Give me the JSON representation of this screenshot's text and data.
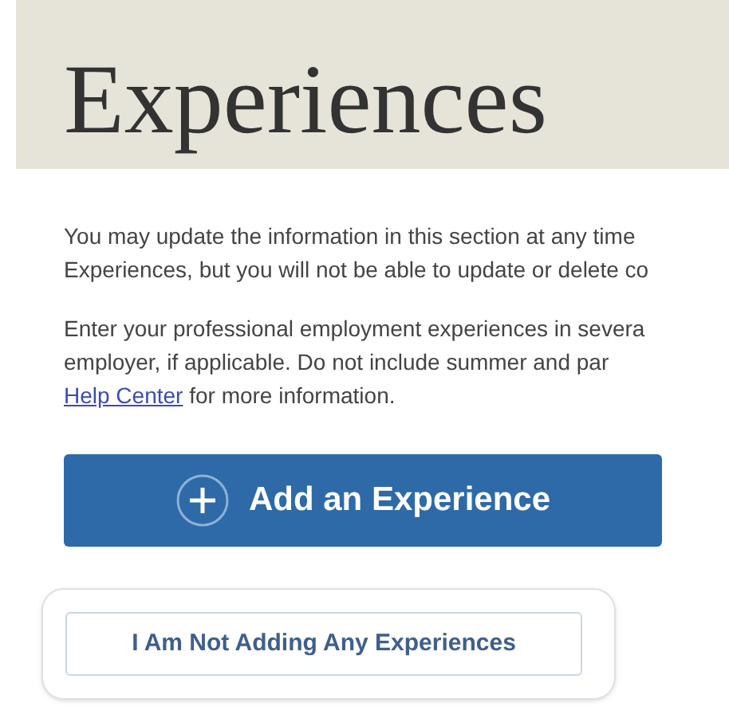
{
  "header": {
    "title": "Experiences"
  },
  "paragraphs": [
    {
      "lines": [
        "You may update the information in this section at any time",
        "Experiences, but you will not be able to update or delete co"
      ]
    },
    {
      "lines": [
        "Enter your professional employment experiences in severa",
        "employer, if applicable. Do not include summer and par"
      ],
      "link": "Help Center",
      "link_tail": " for more information."
    }
  ],
  "add_button": {
    "label": "Add an Experience"
  },
  "none_button": {
    "label": "I Am Not Adding Any Experiences"
  }
}
